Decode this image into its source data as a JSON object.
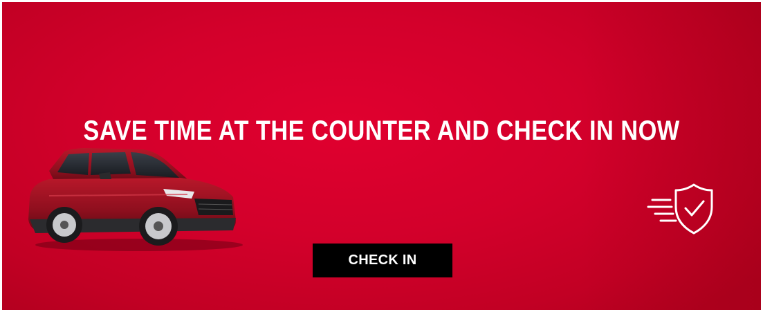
{
  "banner": {
    "headline": "SAVE TIME AT THE COUNTER AND CHECK IN NOW",
    "button_label": "CHECK IN",
    "colors": {
      "background": "#d3002b",
      "button": "#000000",
      "text": "#ffffff"
    },
    "icons": {
      "car": "red-suv-car-image",
      "shield": "fast-shield-check-icon"
    }
  }
}
